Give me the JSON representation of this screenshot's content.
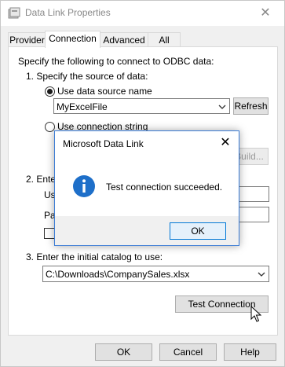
{
  "window": {
    "title": "Data Link Properties",
    "close_glyph": "✕"
  },
  "tabs": [
    {
      "label": "Provider"
    },
    {
      "label": "Connection"
    },
    {
      "label": "Advanced"
    },
    {
      "label": "All"
    }
  ],
  "connection": {
    "intro": "Specify the following to connect to ODBC data:",
    "step1": "1. Specify the source of data:",
    "use_dsn_label": "Use data source name",
    "dsn_value": "MyExcelFile",
    "refresh_label": "Refresh",
    "use_connstr_label": "Use connection string",
    "build_label": "Build...",
    "step2_fragment": "2. Ente",
    "user_fragment": "Us",
    "pass_fragment": "Pa",
    "step3": "3. Enter the initial catalog to use:",
    "catalog_value": "C:\\Downloads\\CompanySales.xlsx",
    "test_connection_label": "Test Connection"
  },
  "footer": {
    "ok_label": "OK",
    "cancel_label": "Cancel",
    "help_label": "Help"
  },
  "dialog": {
    "title": "Microsoft Data Link",
    "message": "Test connection succeeded.",
    "ok_label": "OK",
    "close_glyph": "✕",
    "info_glyph": "i"
  },
  "colors": {
    "accent": "#0078d7",
    "info_icon": "#1e6fc9"
  }
}
